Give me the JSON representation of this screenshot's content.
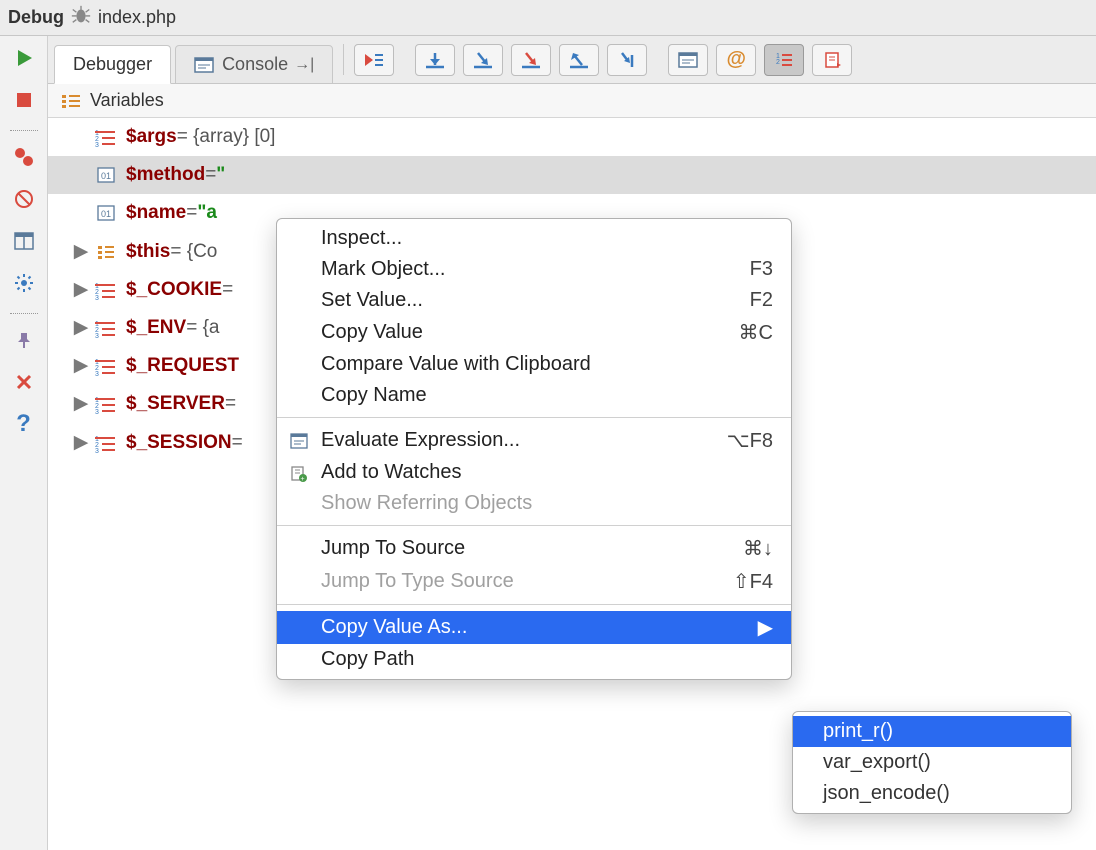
{
  "titlebar": {
    "label": "Debug",
    "file": "index.php"
  },
  "tabs": {
    "debugger": "Debugger",
    "console": "Console"
  },
  "panel": {
    "title": "Variables"
  },
  "vars": [
    {
      "name": "$args",
      "suffix": " = {array} [0]",
      "icon": "array",
      "selected": false,
      "expand": false,
      "valueIsString": false
    },
    {
      "name": "$method",
      "suffix": " = ",
      "icon": "prim",
      "selected": true,
      "expand": false,
      "valueIsString": true,
      "strVal": "\""
    },
    {
      "name": "$name",
      "suffix": " = ",
      "icon": "prim",
      "selected": false,
      "expand": false,
      "valueIsString": true,
      "strVal": "\"a"
    },
    {
      "name": "$this",
      "suffix": " = {Co",
      "icon": "list",
      "selected": false,
      "expand": true,
      "valueIsString": false
    },
    {
      "name": "$_COOKIE",
      "suffix": " =",
      "icon": "array",
      "selected": false,
      "expand": true,
      "valueIsString": false
    },
    {
      "name": "$_ENV",
      "suffix": " = {a",
      "icon": "array",
      "selected": false,
      "expand": true,
      "valueIsString": false
    },
    {
      "name": "$_REQUEST",
      "suffix": "",
      "icon": "array",
      "selected": false,
      "expand": true,
      "valueIsString": false
    },
    {
      "name": "$_SERVER",
      "suffix": " =",
      "icon": "array",
      "selected": false,
      "expand": true,
      "valueIsString": false
    },
    {
      "name": "$_SESSION",
      "suffix": " =",
      "icon": "array",
      "selected": false,
      "expand": true,
      "valueIsString": false
    }
  ],
  "menu": {
    "inspect": "Inspect...",
    "markObject": "Mark Object...",
    "markObjectShort": "F3",
    "setValue": "Set Value...",
    "setValueShort": "F2",
    "copyValue": "Copy Value",
    "copyValueShort": "⌘C",
    "compare": "Compare Value with Clipboard",
    "copyName": "Copy Name",
    "evalExpr": "Evaluate Expression...",
    "evalExprShort": "⌥F8",
    "addWatches": "Add to Watches",
    "showRef": "Show Referring Objects",
    "jumpSrc": "Jump To Source",
    "jumpSrcShort": "⌘↓",
    "jumpType": "Jump To Type Source",
    "jumpTypeShort": "⇧F4",
    "copyValueAs": "Copy Value As...",
    "copyPath": "Copy Path"
  },
  "submenu": {
    "print_r": "print_r()",
    "var_export": "var_export()",
    "json_encode": "json_encode()"
  }
}
